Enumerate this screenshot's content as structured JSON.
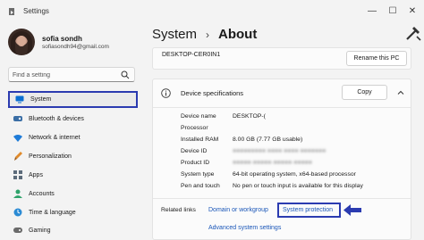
{
  "window": {
    "title": "Settings",
    "minimize": "—",
    "maximize": "☐",
    "close": "✕"
  },
  "user": {
    "name": "sofia sondh",
    "email": "sofiasondh94@gmail.com"
  },
  "search": {
    "placeholder": "Find a setting"
  },
  "sidebar": {
    "items": [
      {
        "label": "System",
        "icon": "monitor-icon",
        "active": true
      },
      {
        "label": "Bluetooth & devices",
        "icon": "bluetooth-icon"
      },
      {
        "label": "Network & internet",
        "icon": "wifi-icon"
      },
      {
        "label": "Personalization",
        "icon": "brush-icon"
      },
      {
        "label": "Apps",
        "icon": "apps-icon"
      },
      {
        "label": "Accounts",
        "icon": "person-icon"
      },
      {
        "label": "Time & language",
        "icon": "globe-clock-icon"
      },
      {
        "label": "Gaming",
        "icon": "gamepad-icon"
      }
    ]
  },
  "header": {
    "parent": "System",
    "chevron": "›",
    "current": "About"
  },
  "pc": {
    "name": "DESKTOP-CER0IN1",
    "rename_label": "Rename this PC"
  },
  "specs": {
    "title": "Device specifications",
    "copy_label": "Copy",
    "rows": [
      {
        "key": "Device name",
        "value": "DESKTOP-("
      },
      {
        "key": "Processor",
        "value": ""
      },
      {
        "key": "Installed RAM",
        "value": "8.00 GB (7.77 GB usable)"
      },
      {
        "key": "Device ID",
        "value": "",
        "blurred": true
      },
      {
        "key": "Product ID",
        "value": "",
        "blurred": true
      },
      {
        "key": "System type",
        "value": "64-bit operating system, x64-based processor"
      },
      {
        "key": "Pen and touch",
        "value": "No pen or touch input is available for this display"
      }
    ]
  },
  "related": {
    "label": "Related links",
    "domain_link": "Domain or workgroup",
    "protection_link": "System protection",
    "advanced_link": "Advanced system settings"
  },
  "colors": {
    "accent": "#1a56b8",
    "highlight_box": "#2b3bb0",
    "background": "#f3f3f3"
  }
}
